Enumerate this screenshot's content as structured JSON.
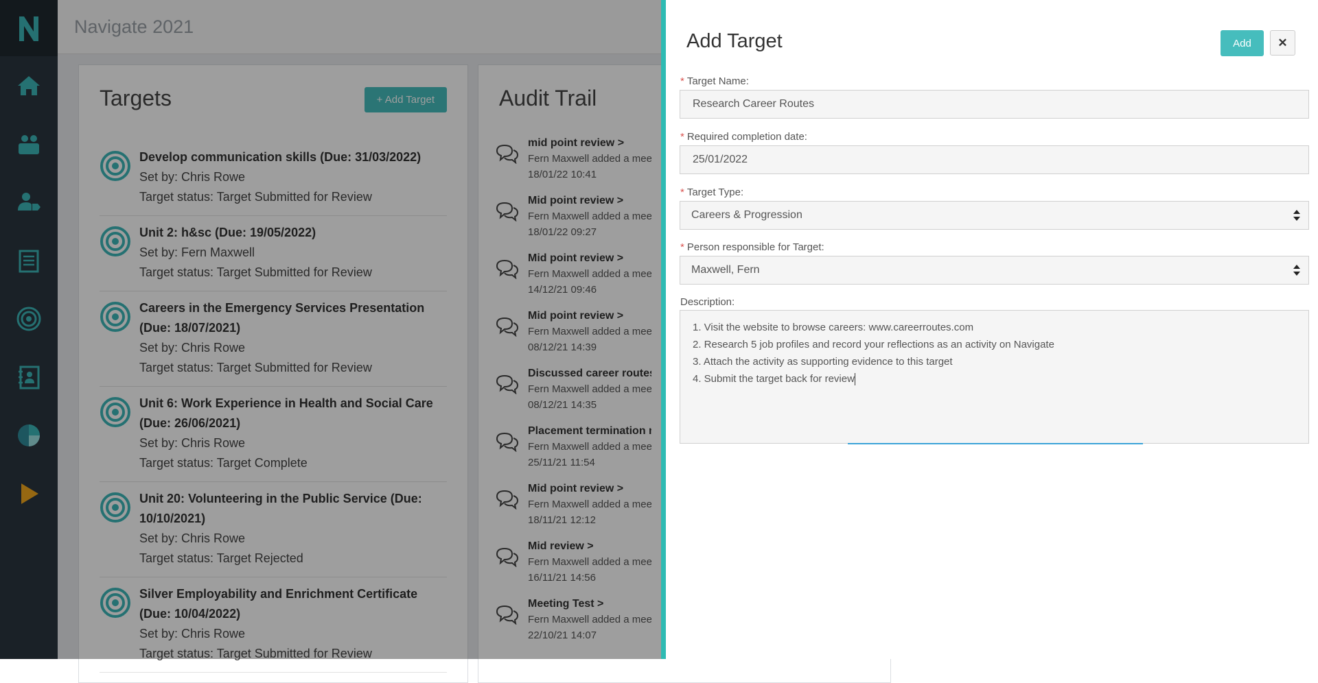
{
  "app": {
    "title": "Navigate 2021"
  },
  "sidebar": {
    "logo": "N",
    "items": [
      {
        "name": "home-icon"
      },
      {
        "name": "people-icon"
      },
      {
        "name": "person-tag-icon"
      },
      {
        "name": "clipboard-icon"
      },
      {
        "name": "target-icon"
      },
      {
        "name": "contacts-book-icon"
      },
      {
        "name": "pie-chart-icon"
      },
      {
        "name": "play-icon"
      }
    ]
  },
  "targets": {
    "title": "Targets",
    "add_button": "+ Add Target",
    "items": [
      {
        "title": "Develop communication skills (Due: 31/03/2022)",
        "set_by": "Set by: Chris Rowe",
        "status": "Target status: Target Submitted for Review"
      },
      {
        "title": "Unit 2: h&sc (Due: 19/05/2022)",
        "set_by": "Set by: Fern Maxwell",
        "status": "Target status: Target Submitted for Review"
      },
      {
        "title": "Careers in the Emergency Services Presentation (Due: 18/07/2021)",
        "set_by": "Set by: Chris Rowe",
        "status": "Target status: Target Submitted for Review"
      },
      {
        "title": "Unit 6: Work Experience in Health and Social Care (Due: 26/06/2021)",
        "set_by": "Set by: Chris Rowe",
        "status": "Target status: Target Complete"
      },
      {
        "title": "Unit 20: Volunteering in the Public Service (Due: 10/10/2021)",
        "set_by": "Set by: Chris Rowe",
        "status": "Target status: Target Rejected"
      },
      {
        "title": "Silver Employability and Enrichment Certificate (Due: 10/04/2022)",
        "set_by": "Set by: Chris Rowe",
        "status": "Target status: Target Submitted for Review"
      }
    ]
  },
  "audit": {
    "title": "Audit Trail",
    "items": [
      {
        "title": "mid point review >",
        "text": "Fern Maxwell added a meet",
        "time": "18/01/22 10:41"
      },
      {
        "title": "Mid point review >",
        "text": "Fern Maxwell added a meet",
        "time": "18/01/22 09:27"
      },
      {
        "title": "Mid point review >",
        "text": "Fern Maxwell added a meet",
        "time": "14/12/21 09:46"
      },
      {
        "title": "Mid point review >",
        "text": "Fern Maxwell added a meet",
        "time": "08/12/21 14:39"
      },
      {
        "title": "Discussed career routes",
        "text": "Fern Maxwell added a meet",
        "time": "08/12/21 14:35"
      },
      {
        "title": "Placement termination m",
        "text": "Fern Maxwell added a meet",
        "time": "25/11/21 11:54"
      },
      {
        "title": "Mid point review >",
        "text": "Fern Maxwell added a meet",
        "time": "18/11/21 12:12"
      },
      {
        "title": "Mid review >",
        "text": "Fern Maxwell added a meet",
        "time": "16/11/21 14:56"
      },
      {
        "title": "Meeting Test >",
        "text": "Fern Maxwell added a meet",
        "time": "22/10/21 14:07"
      }
    ]
  },
  "panel": {
    "title": "Add Target",
    "add_button": "Add",
    "close_button": "✕",
    "target_name_label": "Target Name:",
    "target_name_value": "Research Career Routes",
    "date_label": "Required completion date:",
    "date_value": "25/01/2022",
    "type_label": "Target Type:",
    "type_value": "Careers & Progression",
    "person_label": "Person responsible for Target:",
    "person_value": "Maxwell, Fern",
    "description_label": "Description:",
    "description_lines": [
      "1. Visit the website to browse careers: www.careerroutes.com",
      "2. Research 5 job profiles and record your reflections as an activity on Navigate",
      "3. Attach the activity as supporting evidence to this target",
      "4. Submit the target back for review"
    ],
    "required_marker": "*"
  },
  "colors": {
    "accent": "#46bdbd",
    "panel_border": "#2ebbb3",
    "sidebar": "#2b3640",
    "nav_icon": "#3cb6b8",
    "play_icon": "#f2a81d",
    "required": "#d9534f"
  }
}
